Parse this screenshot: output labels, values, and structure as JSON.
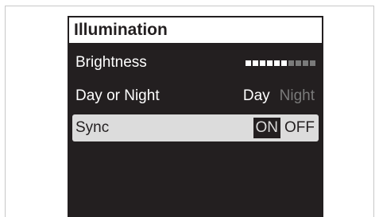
{
  "menu": {
    "title": "Illumination",
    "brightness": {
      "label": "Brightness",
      "level": 6,
      "max": 10,
      "active_color": "#ffffff",
      "inactive_color": "#7a7a7a"
    },
    "day_or_night": {
      "label": "Day or Night",
      "options": [
        "Day",
        "Night"
      ],
      "selected": "Day"
    },
    "sync": {
      "label": "Sync",
      "options": [
        "ON",
        "OFF"
      ],
      "selected": "ON",
      "highlighted": true
    }
  },
  "colors": {
    "screen_bg": "#231f20",
    "highlight_bg": "#dcdcdc",
    "title_bg": "#ffffff"
  }
}
